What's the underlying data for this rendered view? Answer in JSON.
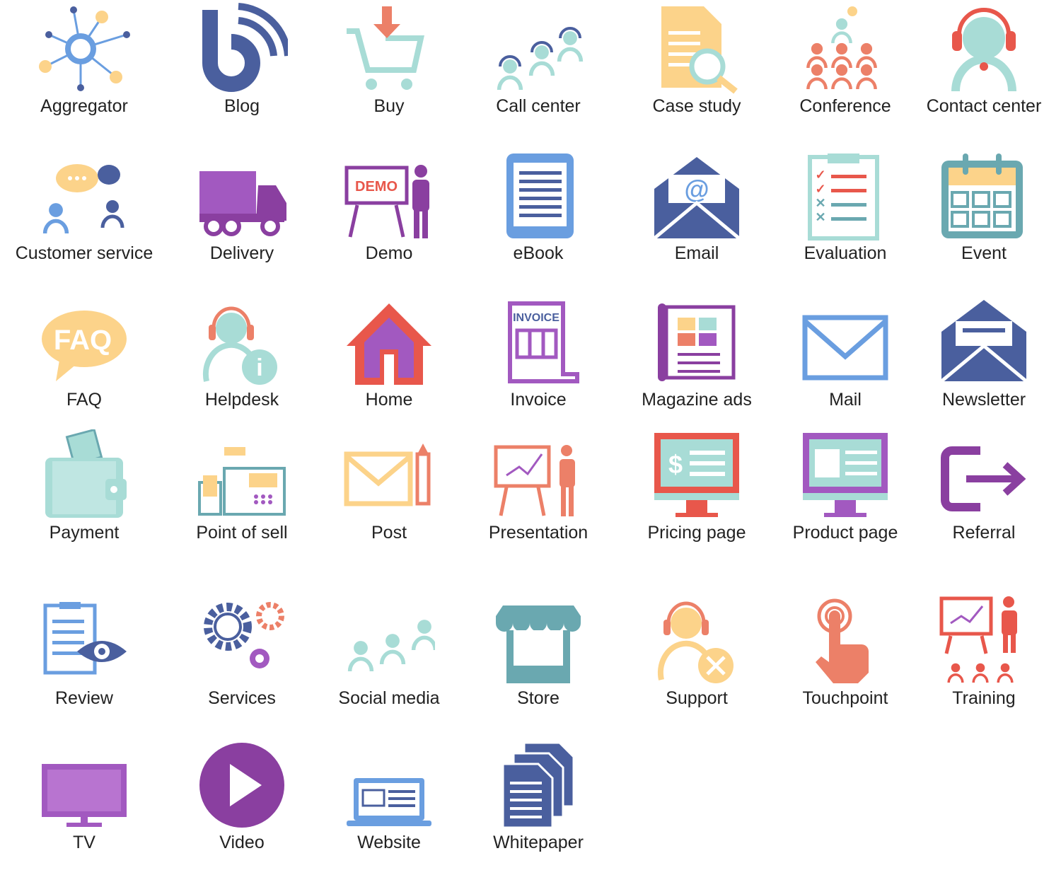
{
  "colors": {
    "dark_blue": "#4a5f9e",
    "blue": "#6a9ee0",
    "teal": "#a8dcd6",
    "dark_teal": "#6aa8b0",
    "yellow": "#fcd38a",
    "red": "#e8574b",
    "salmon": "#ec8068",
    "purple": "#a259c0",
    "dark_purple": "#8a3fa0"
  },
  "icons": [
    {
      "label": "Aggregator",
      "icon": "aggregator-icon"
    },
    {
      "label": "Blog",
      "icon": "blog-icon"
    },
    {
      "label": "Buy",
      "icon": "shopping-cart-icon"
    },
    {
      "label": "Call center",
      "icon": "call-center-icon"
    },
    {
      "label": "Case study",
      "icon": "case-study-icon"
    },
    {
      "label": "Conference",
      "icon": "conference-icon"
    },
    {
      "label": "Contact center",
      "icon": "contact-center-icon"
    },
    {
      "label": "Customer service",
      "icon": "customer-service-icon"
    },
    {
      "label": "Delivery",
      "icon": "delivery-truck-icon"
    },
    {
      "label": "Demo",
      "icon": "demo-icon",
      "text": "DEMO"
    },
    {
      "label": "eBook",
      "icon": "ebook-icon"
    },
    {
      "label": "Email",
      "icon": "email-icon",
      "text": "@"
    },
    {
      "label": "Evaluation",
      "icon": "evaluation-icon"
    },
    {
      "label": "Event",
      "icon": "event-calendar-icon"
    },
    {
      "label": "FAQ",
      "icon": "faq-icon",
      "text": "FAQ"
    },
    {
      "label": "Helpdesk",
      "icon": "helpdesk-icon",
      "text": "i"
    },
    {
      "label": "Home",
      "icon": "home-icon"
    },
    {
      "label": "Invoice",
      "icon": "invoice-icon",
      "text": "INVOICE"
    },
    {
      "label": "Magazine ads",
      "icon": "magazine-icon"
    },
    {
      "label": "Mail",
      "icon": "mail-icon"
    },
    {
      "label": "Newsletter",
      "icon": "newsletter-icon"
    },
    {
      "label": "Payment",
      "icon": "wallet-icon"
    },
    {
      "label": "Point of sell",
      "icon": "cash-register-icon"
    },
    {
      "label": "Post",
      "icon": "post-icon"
    },
    {
      "label": "Presentation",
      "icon": "presentation-icon"
    },
    {
      "label": "Pricing page",
      "icon": "pricing-page-icon",
      "text": "$"
    },
    {
      "label": "Product page",
      "icon": "product-page-icon"
    },
    {
      "label": "Referral",
      "icon": "referral-icon"
    },
    {
      "label": "Review",
      "icon": "review-icon"
    },
    {
      "label": "Services",
      "icon": "services-gears-icon"
    },
    {
      "label": "Social media",
      "icon": "social-media-icon"
    },
    {
      "label": "Store",
      "icon": "store-icon"
    },
    {
      "label": "Support",
      "icon": "support-icon"
    },
    {
      "label": "Touchpoint",
      "icon": "touchpoint-icon"
    },
    {
      "label": "Training",
      "icon": "training-icon"
    },
    {
      "label": "TV",
      "icon": "tv-icon"
    },
    {
      "label": "Video",
      "icon": "video-play-icon"
    },
    {
      "label": "Website",
      "icon": "website-icon"
    },
    {
      "label": "Whitepaper",
      "icon": "whitepaper-icon"
    }
  ]
}
